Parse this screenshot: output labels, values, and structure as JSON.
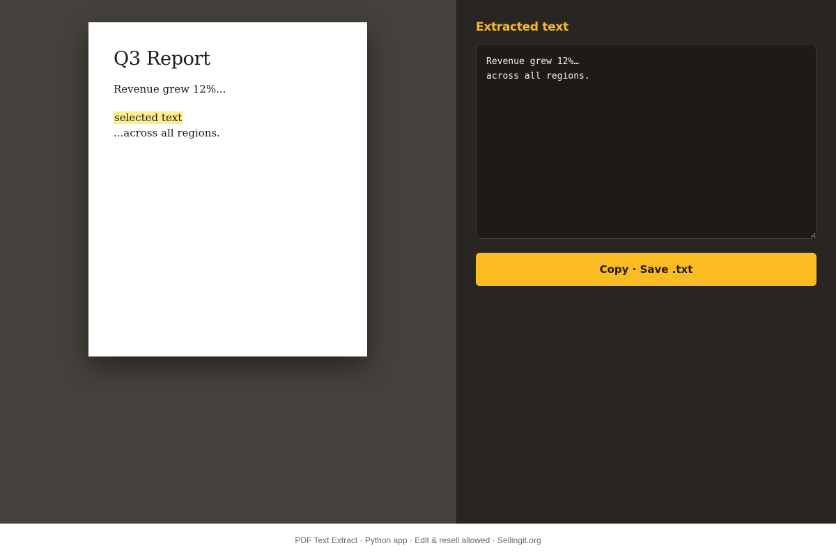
{
  "pdf_page": {
    "title": "Q3 Report",
    "line_1": "Revenue grew 12%...",
    "selection": "selected text",
    "line_3": "...across all regions."
  },
  "panel": {
    "title": "Extracted text",
    "extracted_text": "Revenue grew 12%…\nacross all regions.",
    "button_label": "Copy · Save .txt"
  },
  "footer": {
    "text": "PDF Text Extract · Python app · Edit & resell allowed · Sellingit.org"
  },
  "colors": {
    "accent": "#fbbb22",
    "panel_title": "#f6b72b",
    "selection_highlight": "#fcee8a",
    "left_bg": "#45413c",
    "right_bg": "#292523"
  }
}
